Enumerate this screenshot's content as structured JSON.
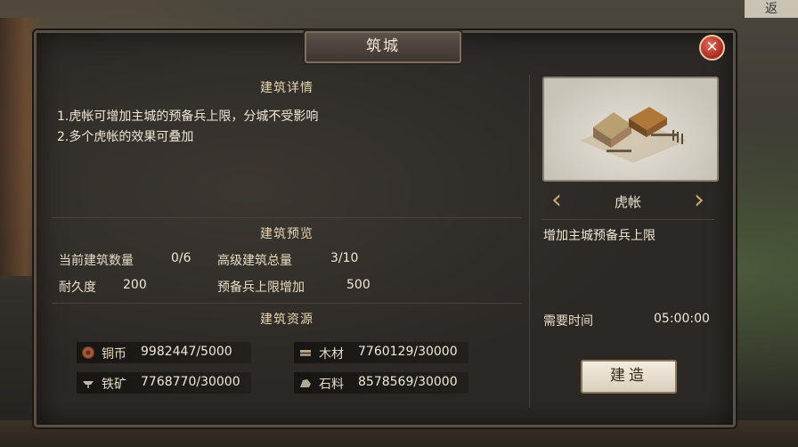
{
  "background": {
    "corner_hint": "返"
  },
  "dialog": {
    "title": "筑城",
    "close_label": "✕"
  },
  "details": {
    "heading": "建筑详情",
    "lines": [
      "1.虎帐可增加主城的预备兵上限，分城不受影响",
      "2.多个虎帐的效果可叠加"
    ]
  },
  "preview": {
    "heading": "建筑预览",
    "stats": [
      {
        "label": "当前建筑数量",
        "value": "0/6"
      },
      {
        "label": "高级建筑总量",
        "value": "3/10"
      },
      {
        "label": "耐久度",
        "value": "200"
      },
      {
        "label": "预备兵上限增加",
        "value": "500"
      }
    ]
  },
  "resources": {
    "heading": "建筑资源",
    "items": [
      {
        "icon": "copper-coin-icon",
        "name": "铜币",
        "value": "9982447/5000"
      },
      {
        "icon": "wood-icon",
        "name": "木材",
        "value": "7760129/30000"
      },
      {
        "icon": "iron-ore-icon",
        "name": "铁矿",
        "value": "7768770/30000"
      },
      {
        "icon": "stone-icon",
        "name": "石料",
        "value": "8578569/30000"
      }
    ]
  },
  "building": {
    "name": "虎帐",
    "description": "增加主城预备兵上限",
    "time_label": "需要时间",
    "time_value": "05:00:00",
    "build_label": "建造",
    "prev_arrow": "‹",
    "next_arrow": "›"
  },
  "colors": {
    "accent": "#c9a86a",
    "close": "#c0392b",
    "panel": "#2b2825"
  }
}
